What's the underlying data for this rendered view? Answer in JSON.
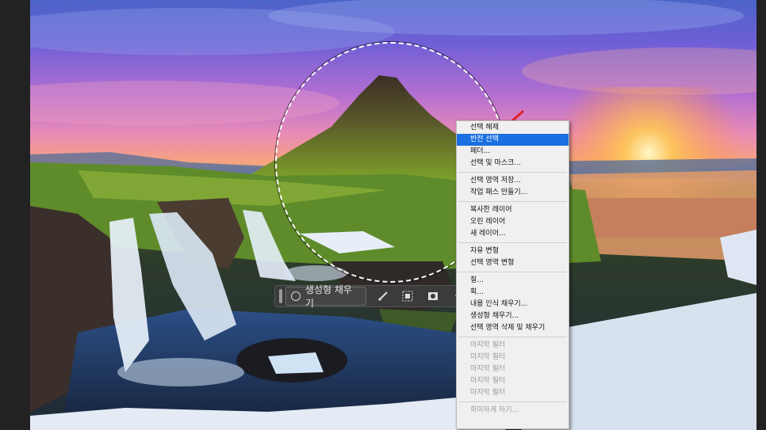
{
  "context_menu": {
    "items": [
      {
        "label": "선택 해제",
        "state": "normal"
      },
      {
        "label": "반전 선택",
        "state": "highlighted"
      },
      {
        "label": "페더...",
        "state": "normal"
      },
      {
        "label": "선택 및 마스크...",
        "state": "normal"
      },
      {
        "type": "separator"
      },
      {
        "label": "선택 영역 저장...",
        "state": "normal"
      },
      {
        "label": "작업 패스 만들기...",
        "state": "normal"
      },
      {
        "type": "separator"
      },
      {
        "label": "복사한 레이어",
        "state": "normal"
      },
      {
        "label": "오린 레이어",
        "state": "normal"
      },
      {
        "label": "새 레이어...",
        "state": "normal"
      },
      {
        "type": "separator"
      },
      {
        "label": "자유 변형",
        "state": "normal"
      },
      {
        "label": "선택 영역 변형",
        "state": "normal"
      },
      {
        "type": "separator"
      },
      {
        "label": "칠...",
        "state": "normal"
      },
      {
        "label": "획...",
        "state": "normal"
      },
      {
        "label": "내용 인식 채우기...",
        "state": "normal"
      },
      {
        "label": "생성형 채우기...",
        "state": "normal"
      },
      {
        "label": "선택 영역 삭제 및 채우기",
        "state": "normal"
      },
      {
        "type": "separator"
      },
      {
        "label": "마지막 필터",
        "state": "disabled"
      },
      {
        "label": "마지막 필터",
        "state": "disabled"
      },
      {
        "label": "마지막 필터",
        "state": "disabled"
      },
      {
        "label": "마지막 필터",
        "state": "disabled"
      },
      {
        "label": "마지막 필터",
        "state": "disabled"
      },
      {
        "type": "separator"
      },
      {
        "label": "희미하게 하기...",
        "state": "disabled"
      }
    ]
  },
  "taskbar": {
    "generative_fill_label": "생성형 채우기",
    "icons": [
      "brush-icon",
      "selection-mask-icon",
      "mask-icon",
      "fill-bucket-icon",
      "more-icon"
    ]
  },
  "colors": {
    "menu_highlight": "#1b6fe0",
    "annotation_arrow": "#e0202a",
    "cursor_highlight": "#ffec3c"
  }
}
